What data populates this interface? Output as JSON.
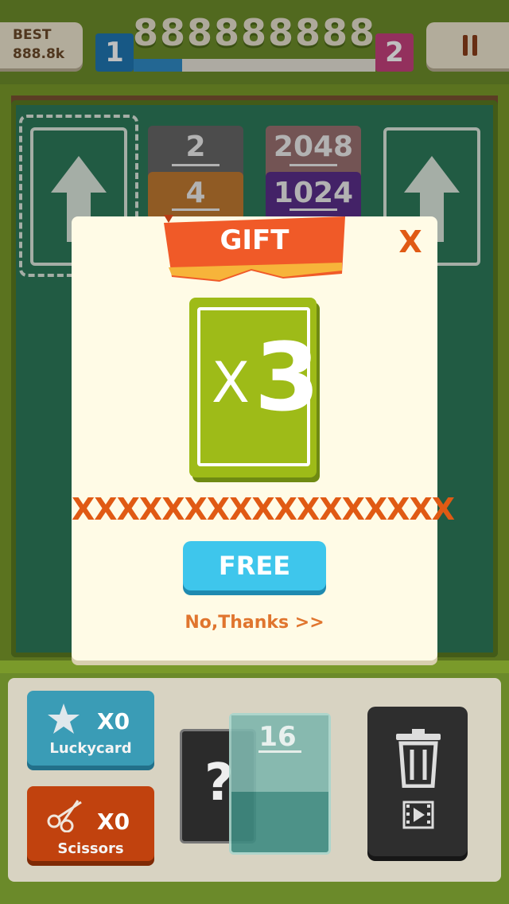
{
  "header": {
    "best_label": "BEST",
    "best_value": "888.8k",
    "score": "888888888",
    "player1": "1",
    "player2": "2",
    "progress": 0.2
  },
  "board": {
    "tiles": [
      {
        "value": "2",
        "color": "#666666"
      },
      {
        "value": "2048",
        "color": "#9a7070"
      },
      {
        "value": "4",
        "color": "#c07a30"
      },
      {
        "value": "1024",
        "color": "#5a2e8a"
      }
    ]
  },
  "modal": {
    "title": "GIFT",
    "close_label": "X",
    "card_prefix": "X",
    "card_multiplier": "3",
    "description": "XXXXXXXXXXXXXXXXX",
    "free_label": "FREE",
    "no_thanks_label": "No,Thanks >>"
  },
  "tray": {
    "lucky_count": "X0",
    "lucky_label": "Luckycard",
    "scissors_count": "X0",
    "scissors_label": "Scissors",
    "mystery_symbol": "?",
    "next_tile_value": "16"
  },
  "colors": {
    "accent_orange": "#e05a14",
    "free_blue": "#3ec6ec",
    "board_green": "#2d7a5a"
  }
}
